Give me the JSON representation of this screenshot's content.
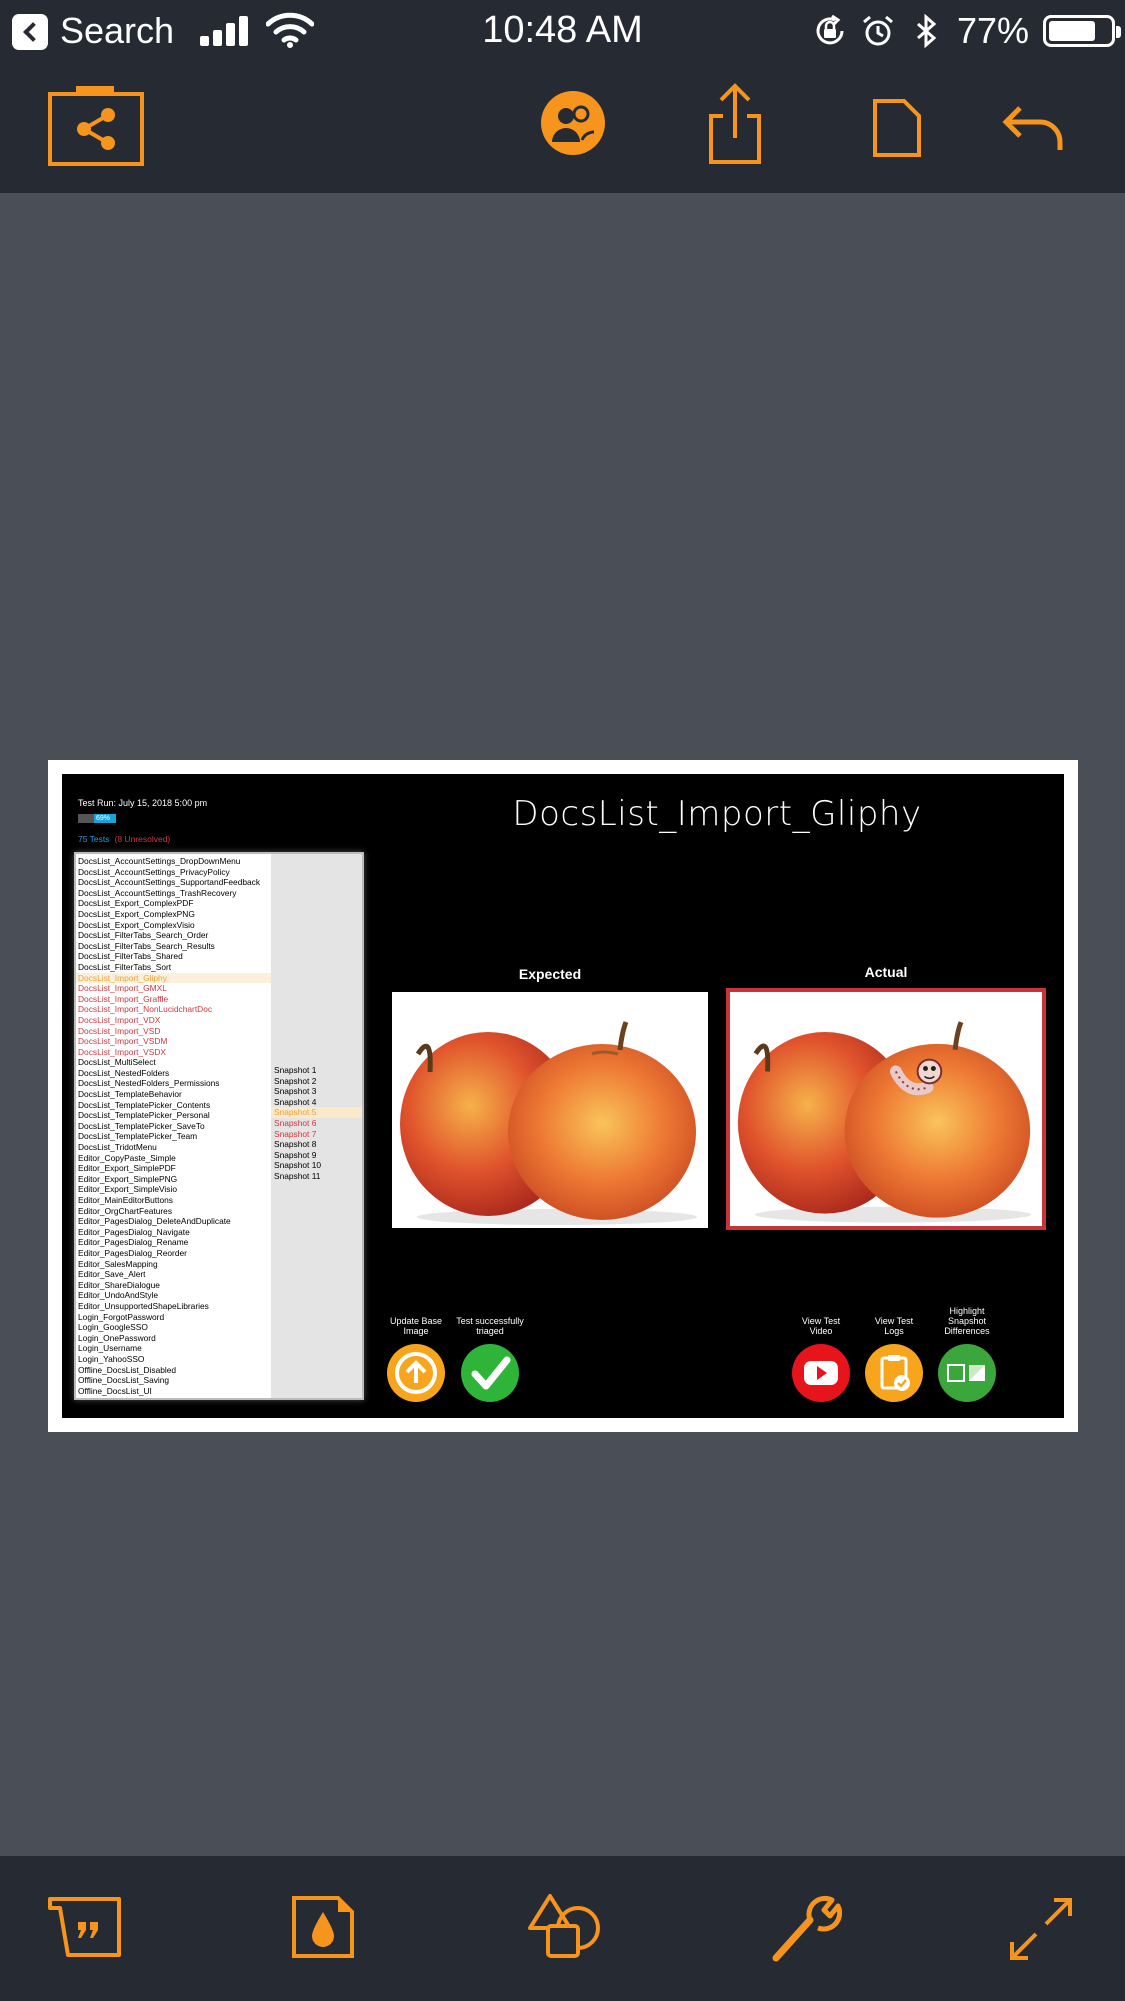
{
  "status_bar": {
    "back_label": "Search",
    "time": "10:48 AM",
    "battery": "77%"
  },
  "document": {
    "run_info": "Test Run: July 15, 2018 5:00 pm",
    "progress_label": "69%",
    "total_tests": "75 Tests",
    "unresolved": "(8 Unresolved)",
    "test_name": "DocsList_Import_Gliphy",
    "expected_label": "Expected",
    "actual_label": "Actual",
    "tests": [
      {
        "name": "DocsList_AccountSettings_DropDownMenu",
        "state": "pass"
      },
      {
        "name": "DocsList_AccountSettings_PrivacyPolicy",
        "state": "pass"
      },
      {
        "name": "DocsList_AccountSettings_SupportandFeedback",
        "state": "pass"
      },
      {
        "name": "DocsList_AccountSettings_TrashRecovery",
        "state": "pass"
      },
      {
        "name": "DocsList_Export_ComplexPDF",
        "state": "pass"
      },
      {
        "name": "DocsList_Export_ComplexPNG",
        "state": "pass"
      },
      {
        "name": "DocsList_Export_ComplexVisio",
        "state": "pass"
      },
      {
        "name": "DocsList_FilterTabs_Search_Order",
        "state": "pass"
      },
      {
        "name": "DocsList_FilterTabs_Search_Results",
        "state": "pass"
      },
      {
        "name": "DocsList_FilterTabs_Shared",
        "state": "pass"
      },
      {
        "name": "DocsList_FilterTabs_Sort",
        "state": "pass"
      },
      {
        "name": "DocsList_Import_Gliphy",
        "state": "selected"
      },
      {
        "name": "DocsList_Import_GMXL",
        "state": "fail"
      },
      {
        "name": "DocsList_Import_Graffle",
        "state": "fail"
      },
      {
        "name": "DocsList_Import_NonLucidchartDoc",
        "state": "fail"
      },
      {
        "name": "DocsList_Import_VDX",
        "state": "fail"
      },
      {
        "name": "DocsList_Import_VSD",
        "state": "fail"
      },
      {
        "name": "DocsList_Import_VSDM",
        "state": "fail"
      },
      {
        "name": "DocsList_Import_VSDX",
        "state": "fail"
      },
      {
        "name": "DocsList_MultiSelect",
        "state": "pass"
      },
      {
        "name": "DocsList_NestedFolders",
        "state": "pass"
      },
      {
        "name": "DocsList_NestedFolders_Permissions",
        "state": "pass"
      },
      {
        "name": "DocsList_TemplateBehavior",
        "state": "pass"
      },
      {
        "name": "DocsList_TemplatePicker_Contents",
        "state": "pass"
      },
      {
        "name": "DocsList_TemplatePicker_Personal",
        "state": "pass"
      },
      {
        "name": "DocsList_TemplatePicker_SaveTo",
        "state": "pass"
      },
      {
        "name": "DocsList_TemplatePicker_Team",
        "state": "pass"
      },
      {
        "name": "DocsList_TridotMenu",
        "state": "pass"
      },
      {
        "name": "Editor_CopyPaste_Simple",
        "state": "pass"
      },
      {
        "name": "Editor_Export_SimplePDF",
        "state": "pass"
      },
      {
        "name": "Editor_Export_SimplePNG",
        "state": "pass"
      },
      {
        "name": "Editor_Export_SimpleVisio",
        "state": "pass"
      },
      {
        "name": "Editor_MainEditorButtons",
        "state": "pass"
      },
      {
        "name": "Editor_OrgChartFeatures",
        "state": "pass"
      },
      {
        "name": "Editor_PagesDialog_DeleteAndDuplicate",
        "state": "pass"
      },
      {
        "name": "Editor_PagesDialog_Navigate",
        "state": "pass"
      },
      {
        "name": "Editor_PagesDialog_Rename",
        "state": "pass"
      },
      {
        "name": "Editor_PagesDialog_Reorder",
        "state": "pass"
      },
      {
        "name": "Editor_SalesMapping",
        "state": "pass"
      },
      {
        "name": "Editor_Save_Alert",
        "state": "pass"
      },
      {
        "name": "Editor_ShareDialogue",
        "state": "pass"
      },
      {
        "name": "Editor_UndoAndStyle",
        "state": "pass"
      },
      {
        "name": "Editor_UnsupportedShapeLibraries",
        "state": "pass"
      },
      {
        "name": "Login_ForgotPassword",
        "state": "pass"
      },
      {
        "name": "Login_GoogleSSO",
        "state": "pass"
      },
      {
        "name": "Login_OnePassword",
        "state": "pass"
      },
      {
        "name": "Login_Username",
        "state": "pass"
      },
      {
        "name": "Login_YahooSSO",
        "state": "pass"
      },
      {
        "name": "Offline_DocsList_Disabled",
        "state": "pass"
      },
      {
        "name": "Offline_DocsList_Saving",
        "state": "pass"
      },
      {
        "name": "Offline_DocsList_UI",
        "state": "pass"
      }
    ],
    "snapshots": [
      {
        "name": "Snapshot 1",
        "state": "pass"
      },
      {
        "name": "Snapshot 2",
        "state": "pass"
      },
      {
        "name": "Snapshot 3",
        "state": "pass"
      },
      {
        "name": "Snapshot 4",
        "state": "pass"
      },
      {
        "name": "Snapshot 5",
        "state": "selected"
      },
      {
        "name": "Snapshot 6",
        "state": "fail"
      },
      {
        "name": "Snapshot 7",
        "state": "fail"
      },
      {
        "name": "Snapshot 8",
        "state": "pass"
      },
      {
        "name": "Snapshot 9",
        "state": "pass"
      },
      {
        "name": "Snapshot 10",
        "state": "pass"
      },
      {
        "name": "Snapshot 11",
        "state": "pass"
      }
    ],
    "actions": {
      "update_base": "Update Base Image",
      "triaged": "Test successfully triaged",
      "view_video": "View Test Video",
      "view_logs": "View Test Logs",
      "highlight": "Highlight Snapshot Differences"
    }
  },
  "icons": {
    "toolbar": [
      "share-nodes-icon",
      "collaborators-icon",
      "export-icon",
      "page-icon",
      "undo-icon"
    ],
    "bottombar": [
      "comment-icon",
      "fill-color-icon",
      "shapes-icon",
      "tools-icon",
      "fullscreen-icon"
    ]
  },
  "colors": {
    "accent": "#f7941d",
    "chrome": "#262b33",
    "canvas": "#4a4f57",
    "fail": "#d0383f",
    "progress": "#1aa3db"
  }
}
